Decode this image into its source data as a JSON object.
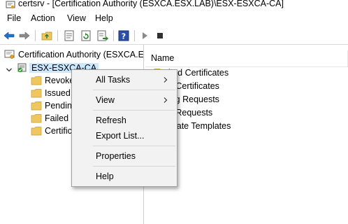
{
  "window": {
    "title": "certsrv - [Certification Authority (ESXCA.ESX.LAB)\\ESX-ESXCA-CA]",
    "icon": "certsrv-app-icon"
  },
  "menubar": {
    "items": [
      "File",
      "Action",
      "View",
      "Help"
    ]
  },
  "toolbar": {
    "buttons": [
      "back-icon",
      "forward-icon",
      "up-folder-icon",
      "properties-icon",
      "refresh-icon",
      "export-list-icon",
      "help-icon",
      "start-service-icon",
      "stop-service-icon"
    ]
  },
  "tree": {
    "root": {
      "label": "Certification Authority (ESXCA.ES",
      "icon": "certificate-authority-icon"
    },
    "ca": {
      "label": "ESX-ESXCA-CA",
      "icon": "ca-server-icon",
      "expanded": true,
      "selected": true
    },
    "children": [
      {
        "label": "Revoke",
        "icon": "folder-icon"
      },
      {
        "label": "Issued",
        "icon": "folder-icon"
      },
      {
        "label": "Pendin",
        "icon": "folder-icon"
      },
      {
        "label": "Failed I",
        "icon": "folder-icon"
      },
      {
        "label": "Certific",
        "icon": "folder-icon"
      }
    ]
  },
  "list": {
    "column": "Name",
    "rows": [
      {
        "label": "oked Certificates",
        "icon": "folder-icon"
      },
      {
        "label": "ed Certificates",
        "icon": "folder-icon"
      },
      {
        "label": "ding Requests",
        "icon": "folder-icon"
      },
      {
        "label": "ed Requests",
        "icon": "folder-icon"
      },
      {
        "label": "tificate Templates",
        "icon": "folder-icon"
      }
    ]
  },
  "context_menu": {
    "groups": [
      [
        {
          "label": "All Tasks",
          "submenu": true
        }
      ],
      [
        {
          "label": "View",
          "submenu": true
        }
      ],
      [
        {
          "label": "Refresh",
          "submenu": false
        },
        {
          "label": "Export List...",
          "submenu": false
        }
      ],
      [
        {
          "label": "Properties",
          "submenu": false
        }
      ],
      [
        {
          "label": "Help",
          "submenu": false
        }
      ]
    ]
  },
  "colors": {
    "selection": "#cce8ff",
    "folder": "#f0c75e",
    "menu_bg": "#f2f2f2",
    "nav_arrow": "#1e74c6"
  }
}
